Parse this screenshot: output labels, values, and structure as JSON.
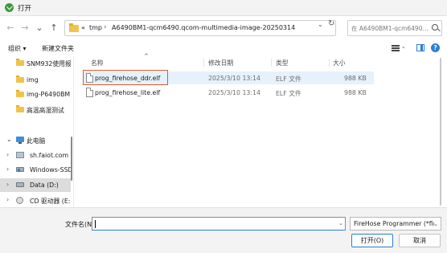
{
  "window": {
    "title": "打开"
  },
  "nav": {
    "back": "←",
    "forward": "→",
    "recent": "⌄",
    "up": "↑",
    "path": [
      "«",
      "tmp",
      "A6490BM1-qcm6490.qcom-multimedia-image-20250314"
    ],
    "path_sep": "›",
    "refresh": "↻",
    "search_placeholder": "在 A6490BM1-qcm6490..."
  },
  "toolbar": {
    "organize": "组织 ▾",
    "new_folder": "新建文件夹",
    "help": "?"
  },
  "sidebar": {
    "items": [
      {
        "label": "SNM932使用报"
      },
      {
        "label": "img"
      },
      {
        "label": "img-P6490BM"
      },
      {
        "label": "高温高湿测试"
      },
      {
        "label": "此电脑"
      },
      {
        "label": "sh.faiot.com"
      },
      {
        "label": "Windows-SSD"
      },
      {
        "label": "Data (D:)"
      },
      {
        "label": "CD 驱动器 (E:"
      }
    ],
    "chev_closed": "›",
    "chev_open": "⌄"
  },
  "columns": {
    "name": "名称",
    "modified": "修改日期",
    "type": "类型",
    "size": "大小",
    "sort_caret": "^"
  },
  "files": [
    {
      "name": "prog_firehose_ddr.elf",
      "modified": "2025/3/10 13:14",
      "type": "ELF 文件",
      "size": "988 KB"
    },
    {
      "name": "prog_firehose_lite.elf",
      "modified": "2025/3/10 13:14",
      "type": "ELF 文件",
      "size": "988 KB"
    }
  ],
  "footer": {
    "filename_label": "文件名(N):",
    "filename_value": "",
    "filetype": "FireHose Programmer (*firel",
    "open": "打开(O)",
    "cancel": "取消"
  },
  "colors": {
    "accent": "#2a7fd4",
    "highlight": "#e4572e",
    "selected_row": "#e5f1fb"
  }
}
